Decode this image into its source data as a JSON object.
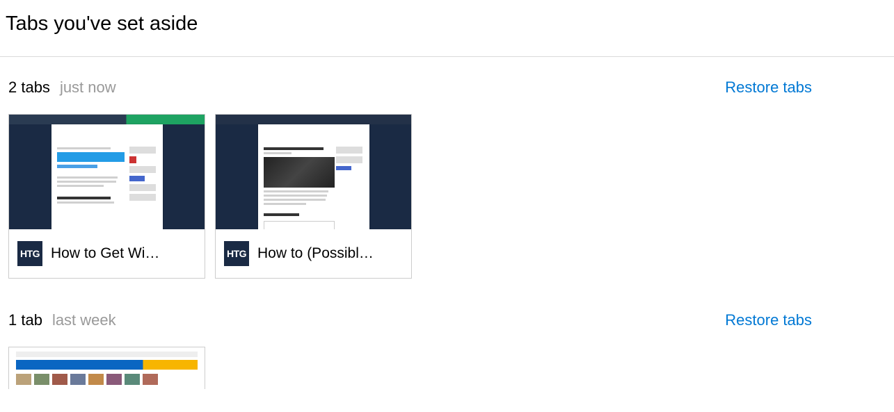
{
  "header": {
    "title": "Tabs you've set aside"
  },
  "groups": [
    {
      "count_label": "2 tabs",
      "time_label": "just now",
      "restore_label": "Restore tabs",
      "tabs": [
        {
          "favicon_text": "HTG",
          "title": "How to Get Wi…"
        },
        {
          "favicon_text": "HTG",
          "title": "How to (Possibl…"
        }
      ]
    },
    {
      "count_label": "1 tab",
      "time_label": "last week",
      "restore_label": "Restore tabs",
      "tabs": [
        {
          "favicon_text": "",
          "title": ""
        }
      ]
    }
  ]
}
